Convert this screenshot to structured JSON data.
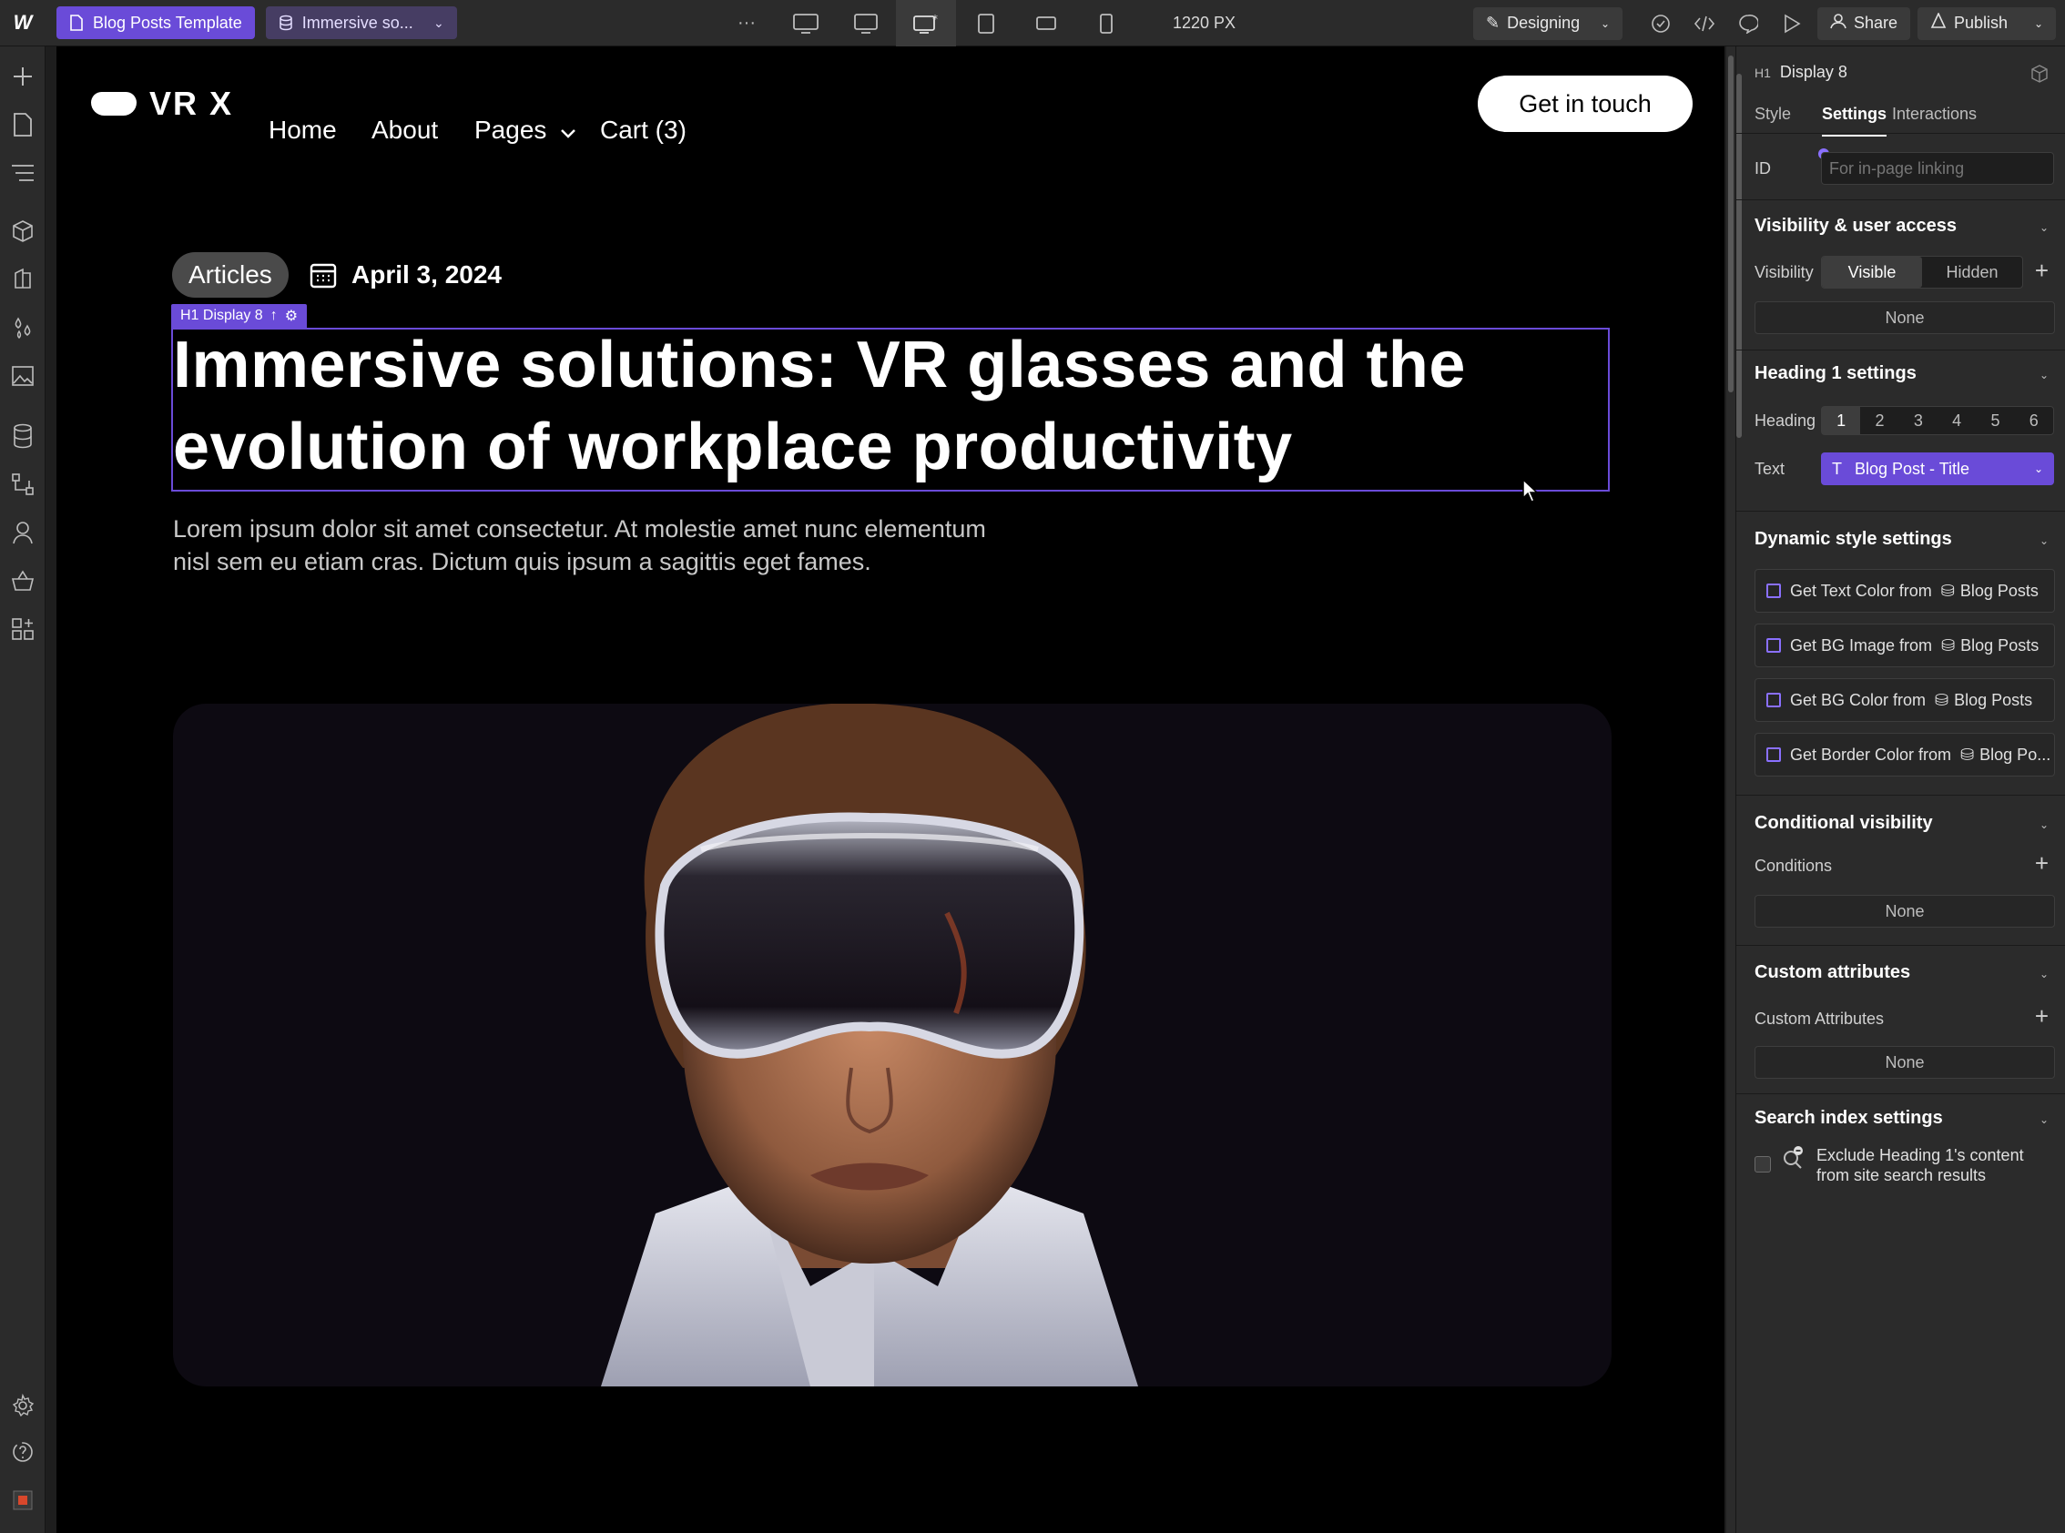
{
  "topbar": {
    "page_label": "Blog Posts Template",
    "collection_label": "Immersive so...",
    "more_label": "···",
    "breakpoint_width": "1220 PX",
    "mode_label": "Designing",
    "share_label": "Share",
    "publish_label": "Publish"
  },
  "site": {
    "brand": "VR X",
    "nav": [
      "Home",
      "About",
      "Pages",
      "Cart (3)"
    ],
    "cta": "Get in touch",
    "tag": "Articles",
    "date": "April 3, 2024",
    "selection_label": "H1 Display 8",
    "headline_line1": "Immersive solutions: VR glasses and the",
    "headline_line2": "evolution of workplace productivity",
    "lead_line1": "Lorem ipsum dolor sit amet consectetur. At molestie amet nunc elementum",
    "lead_line2": "nisl sem eu etiam cras. Dictum quis ipsum a sagittis eget fames."
  },
  "panel": {
    "element_tag": "H1",
    "element_name": "Display 8",
    "tabs": [
      "Style",
      "Settings",
      "Interactions"
    ],
    "active_tab": "Settings",
    "id_label": "ID",
    "id_placeholder": "For in-page linking",
    "visibility_section": "Visibility & user access",
    "visibility_label": "Visibility",
    "visibility_options": [
      "Visible",
      "Hidden"
    ],
    "visibility_value": "Visible",
    "visibility_none": "None",
    "heading_section": "Heading 1 settings",
    "heading_label": "Heading",
    "heading_levels": [
      "1",
      "2",
      "3",
      "4",
      "5",
      "6"
    ],
    "heading_level_selected": "1",
    "text_label": "Text",
    "text_binding_icon": "T",
    "text_binding": "Blog Post - Title",
    "dynamic_section": "Dynamic style settings",
    "dynamic_rows": [
      {
        "label": "Get Text Color from",
        "collection": "Blog Posts"
      },
      {
        "label": "Get BG Image from",
        "collection": "Blog Posts"
      },
      {
        "label": "Get BG Color from",
        "collection": "Blog Posts"
      },
      {
        "label": "Get Border Color from",
        "collection": "Blog Po..."
      }
    ],
    "conditional_section": "Conditional visibility",
    "conditions_label": "Conditions",
    "conditions_none": "None",
    "custom_attr_section": "Custom attributes",
    "custom_attr_label": "Custom Attributes",
    "custom_attr_none": "None",
    "search_section": "Search index settings",
    "search_exclude_line1": "Exclude Heading 1's content",
    "search_exclude_line2": "from site search results"
  },
  "colors": {
    "accent": "#6a4bd8",
    "chrome": "#2b2b2b",
    "canvas": "#000000"
  }
}
